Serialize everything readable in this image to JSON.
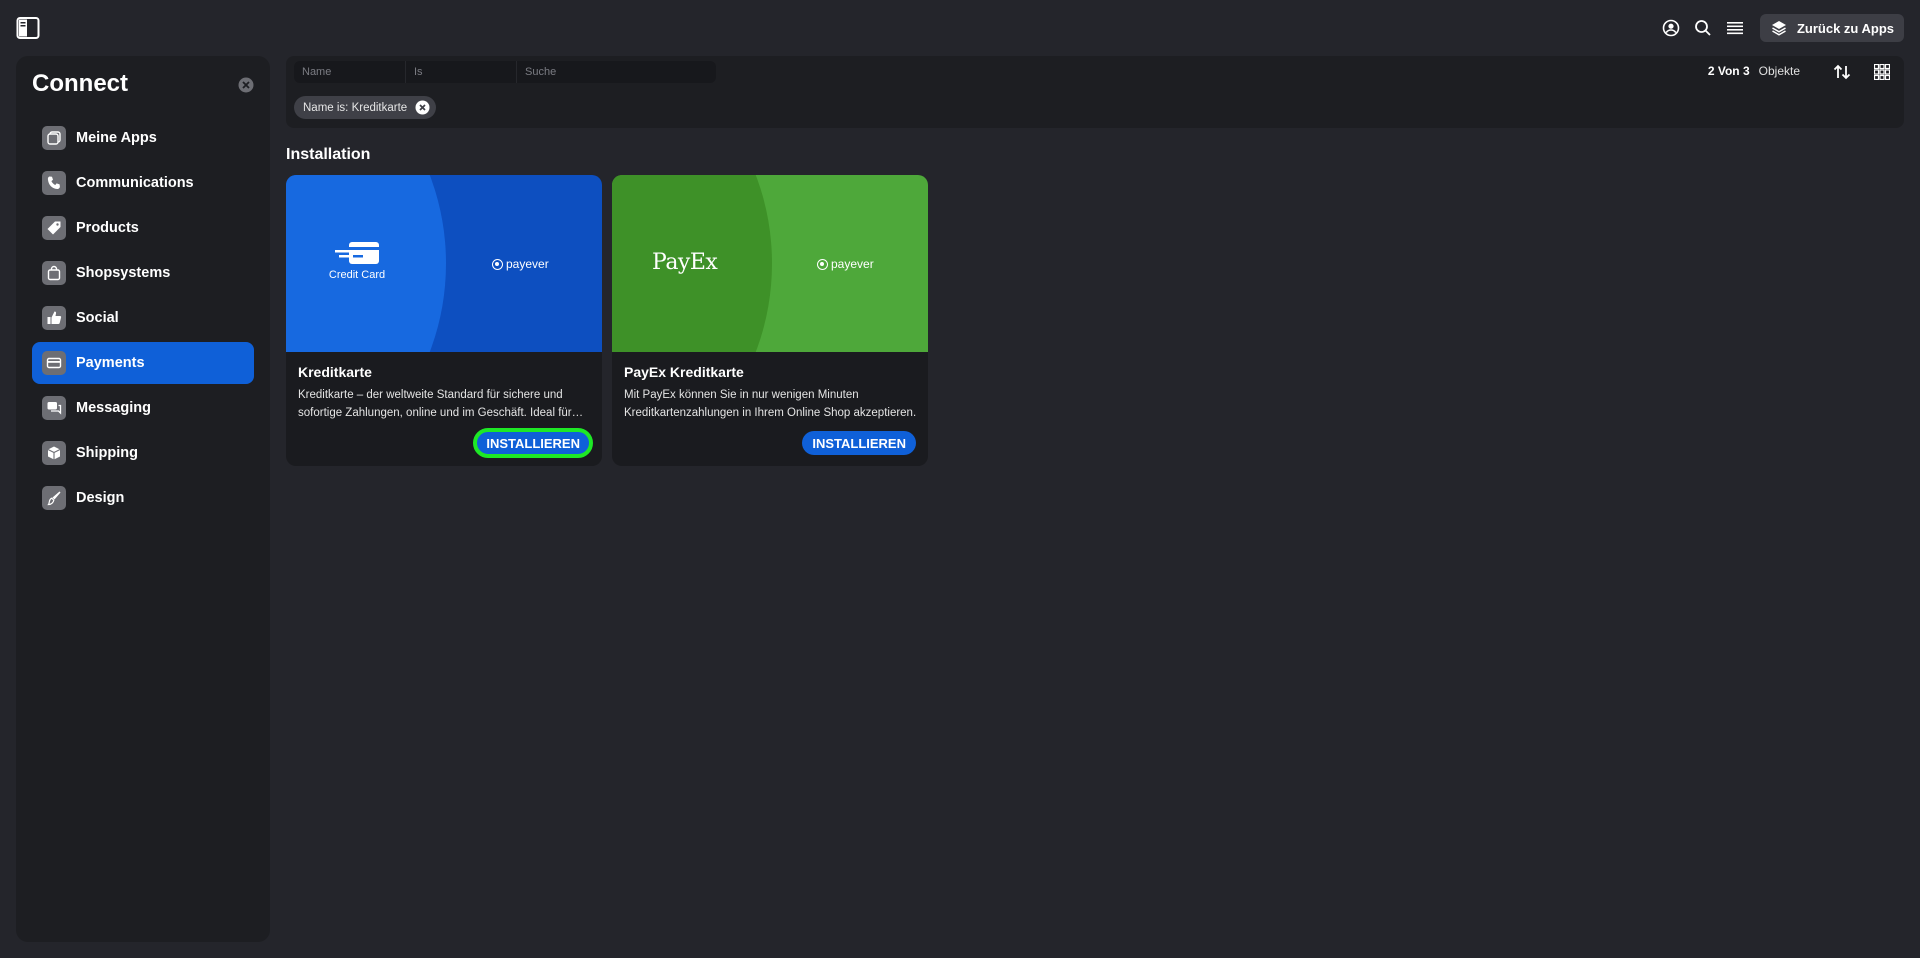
{
  "topbar": {
    "back_label": "Zurück zu Apps",
    "icons": [
      "sidebar-toggle-icon",
      "account-icon",
      "search-icon",
      "menu-icon",
      "layers-icon"
    ]
  },
  "sidebar": {
    "title": "Connect",
    "items": [
      {
        "label": "Meine Apps",
        "icon": "apps-icon",
        "active": false
      },
      {
        "label": "Communications",
        "icon": "phone-icon",
        "active": false
      },
      {
        "label": "Products",
        "icon": "tag-icon",
        "active": false
      },
      {
        "label": "Shopsystems",
        "icon": "shopping-bag-icon",
        "active": false
      },
      {
        "label": "Social",
        "icon": "thumbs-up-icon",
        "active": false
      },
      {
        "label": "Payments",
        "icon": "credit-card-icon",
        "active": true
      },
      {
        "label": "Messaging",
        "icon": "chat-icon",
        "active": false
      },
      {
        "label": "Shipping",
        "icon": "box-icon",
        "active": false
      },
      {
        "label": "Design",
        "icon": "brush-icon",
        "active": false
      }
    ]
  },
  "filter": {
    "field_placeholder": "Name",
    "operator_placeholder": "Is",
    "search_placeholder": "Suche",
    "chip_label": "Name is: Kreditkarte",
    "count": "2 Von 3",
    "count_label": "Objekte"
  },
  "section": {
    "title": "Installation"
  },
  "cards": [
    {
      "title": "Kreditkarte",
      "description": "Kreditkarte – der weltweite Standard für sichere und sofortige Zahlungen, online und im Geschäft. Ideal für Händler jeder Größe.",
      "button": "INSTALLIEREN",
      "logo_left": "Credit Card",
      "logo_right": "payever"
    },
    {
      "title": "PayEx Kreditkarte",
      "description": "Mit PayEx können Sie in nur wenigen Minuten Kreditkartenzahlungen in Ihrem Online Shop akzeptieren.",
      "button": "INSTALLIEREN",
      "logo_left": "PayEx",
      "logo_right": "payever"
    }
  ],
  "colors": {
    "background": "#24252b",
    "panel": "#1d1e22",
    "accent": "#0f60d8",
    "highlight": "#1ee826",
    "card1_banner": "#0d4fc0",
    "card2_banner": "#4ea83a"
  }
}
